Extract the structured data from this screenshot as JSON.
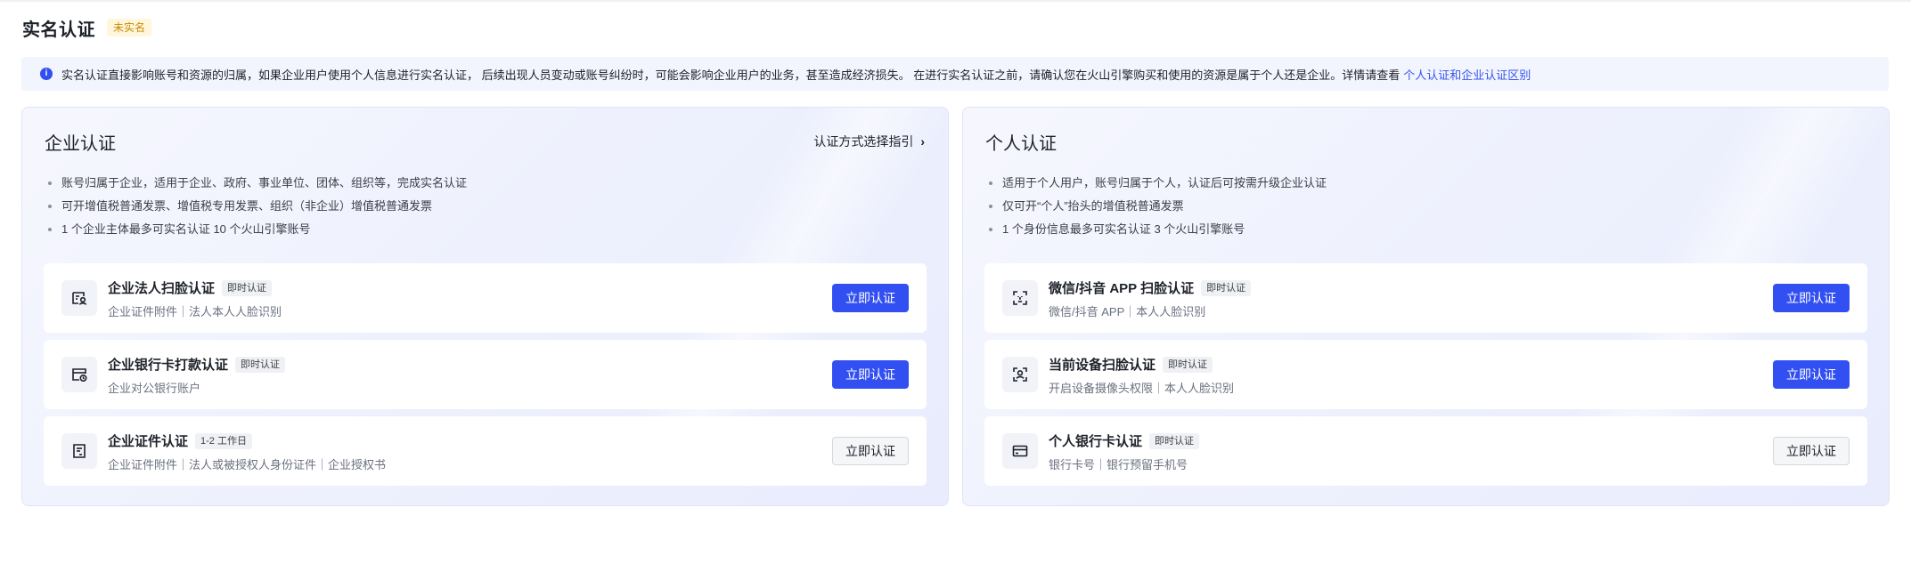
{
  "header": {
    "title": "实名认证",
    "status": "未实名"
  },
  "notice": {
    "text": "实名认证直接影响账号和资源的归属，如果企业用户使用个人信息进行实名认证， 后续出现人员变动或账号纠纷时，可能会影响企业用户的业务，甚至造成经济损失。 在进行实名认证之前，请确认您在火山引擎购买和使用的资源是属于个人还是企业。详情请查看",
    "link": "个人认证和企业认证区别"
  },
  "enterprise": {
    "title": "企业认证",
    "guide": "认证方式选择指引",
    "bullets": [
      "账号归属于企业，适用于企业、政府、事业单位、团体、组织等，完成实名认证",
      "可开增值税普通发票、增值税专用发票、组织（非企业）增值税普通发票",
      "1 个企业主体最多可实名认证 10 个火山引擎账号"
    ],
    "methods": [
      {
        "name": "企业法人扫脸认证",
        "tag": "即时认证",
        "desc": "企业证件附件｜法人本人人脸识别",
        "button": "立即认证",
        "icon": "id-face-icon"
      },
      {
        "name": "企业银行卡打款认证",
        "tag": "即时认证",
        "desc": "企业对公银行账户",
        "button": "立即认证",
        "icon": "bank-card-clock-icon"
      },
      {
        "name": "企业证件认证",
        "tag": "1-2 工作日",
        "desc": "企业证件附件｜法人或被授权人身份证件｜企业授权书",
        "button": "立即认证",
        "icon": "document-icon"
      }
    ]
  },
  "personal": {
    "title": "个人认证",
    "bullets": [
      "适用于个人用户，账号归属于个人，认证后可按需升级企业认证",
      "仅可开“个人”抬头的增值税普通发票",
      "1 个身份信息最多可实名认证 3 个火山引擎账号"
    ],
    "methods": [
      {
        "name": "微信/抖音 APP 扫脸认证",
        "tag": "即时认证",
        "desc": "微信/抖音 APP｜本人人脸识别",
        "button": "立即认证",
        "icon": "face-scan-icon"
      },
      {
        "name": "当前设备扫脸认证",
        "tag": "即时认证",
        "desc": "开启设备摄像头权限｜本人人脸识别",
        "button": "立即认证",
        "icon": "person-scan-icon"
      },
      {
        "name": "个人银行卡认证",
        "tag": "即时认证",
        "desc": "银行卡号｜银行预留手机号",
        "button": "立即认证",
        "icon": "credit-card-icon"
      }
    ]
  },
  "colors": {
    "primary": "#3250f1",
    "badge_text": "#c98b00",
    "badge_bg": "#fff6dc",
    "link": "#3654f0"
  }
}
